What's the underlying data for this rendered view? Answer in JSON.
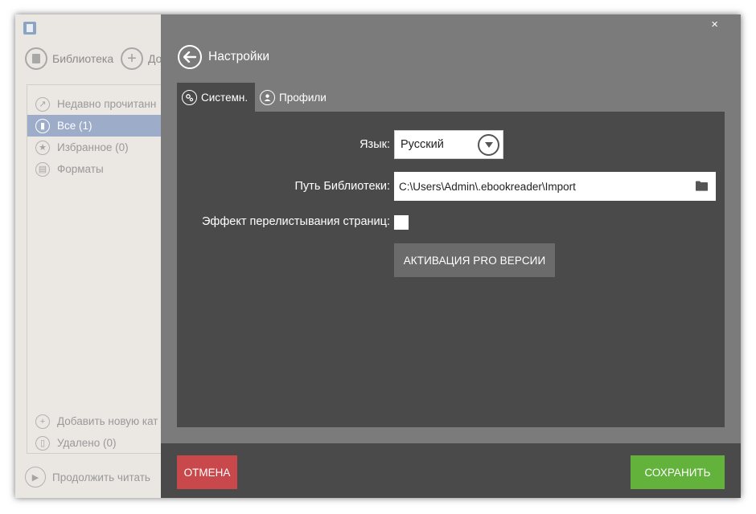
{
  "colors": {
    "overlay_bg": "#7b7b7b",
    "panel_bg": "#4a4a4a",
    "cancel": "#c8484b",
    "save": "#62b23c",
    "active_nav": "#9cacc9"
  },
  "app": {
    "toolbar": [
      {
        "label": "Библиотека",
        "icon": "book-icon"
      },
      {
        "label": "До",
        "icon": "plus-icon"
      }
    ],
    "nav": [
      {
        "label": "Недавно прочитанн",
        "icon": "share-icon"
      },
      {
        "label": "Все (1)",
        "icon": "book-icon"
      },
      {
        "label": "Избранное (0)",
        "icon": "star-icon"
      },
      {
        "label": "Форматы",
        "icon": "file-icon"
      }
    ],
    "bottom_nav": [
      {
        "label": "Добавить новую кат",
        "icon": "plus-icon"
      },
      {
        "label": "Удалено (0)",
        "icon": "trash-icon"
      }
    ],
    "continue_label": "Продолжить читать"
  },
  "settings": {
    "close": "×",
    "title": "Настройки",
    "tabs": [
      {
        "label": "Системн.",
        "icon": "gears-icon"
      },
      {
        "label": "Профили",
        "icon": "user-icon"
      }
    ],
    "language_label": "Язык:",
    "language_value": "Русский",
    "path_label": "Путь Библиотеки:",
    "path_value": "C:\\Users\\Admin\\.ebookreader\\Import",
    "flip_label": "Эффект перелистывания страниц:",
    "pro_button": "АКТИВАЦИЯ PRO ВЕРСИИ",
    "cancel_button": "ОТМЕНА",
    "save_button": "СОХРАНИТЬ"
  }
}
